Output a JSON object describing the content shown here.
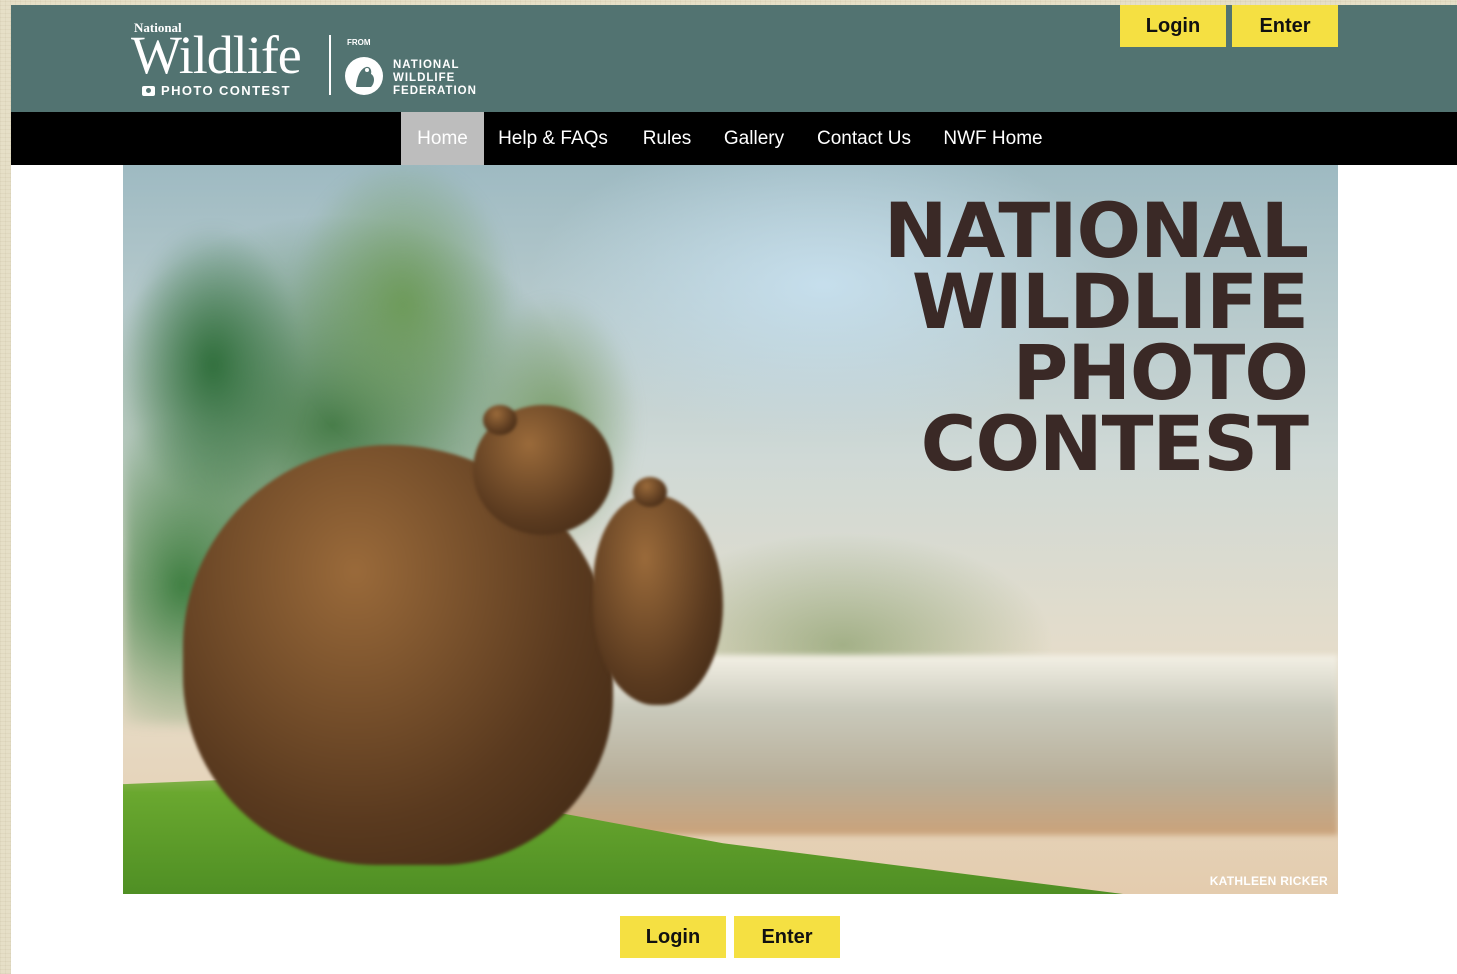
{
  "header": {
    "logo": {
      "national": "National",
      "wildlife": "Wildlife",
      "photo_contest": "PHOTO CONTEST",
      "from": "FROM",
      "nwf_lines": [
        "NATIONAL",
        "WILDLIFE",
        "FEDERATION"
      ]
    },
    "login_label": "Login",
    "enter_label": "Enter",
    "accent_color": "#f5e042",
    "header_color": "#527371"
  },
  "nav": {
    "items": [
      {
        "label": "Home",
        "active": true
      },
      {
        "label": "Help & FAQs",
        "active": false
      },
      {
        "label": "Rules",
        "active": false
      },
      {
        "label": "Gallery",
        "active": false
      },
      {
        "label": "Contact Us",
        "active": false
      },
      {
        "label": "NWF Home",
        "active": false
      }
    ]
  },
  "hero": {
    "title_lines": [
      "NATIONAL",
      "WILDLIFE",
      "PHOTO",
      "CONTEST"
    ],
    "photo_credit": "KATHLEEN RICKER",
    "image_subject": "two brown bears beside a misty river"
  },
  "footer_actions": {
    "login_label": "Login",
    "enter_label": "Enter"
  }
}
